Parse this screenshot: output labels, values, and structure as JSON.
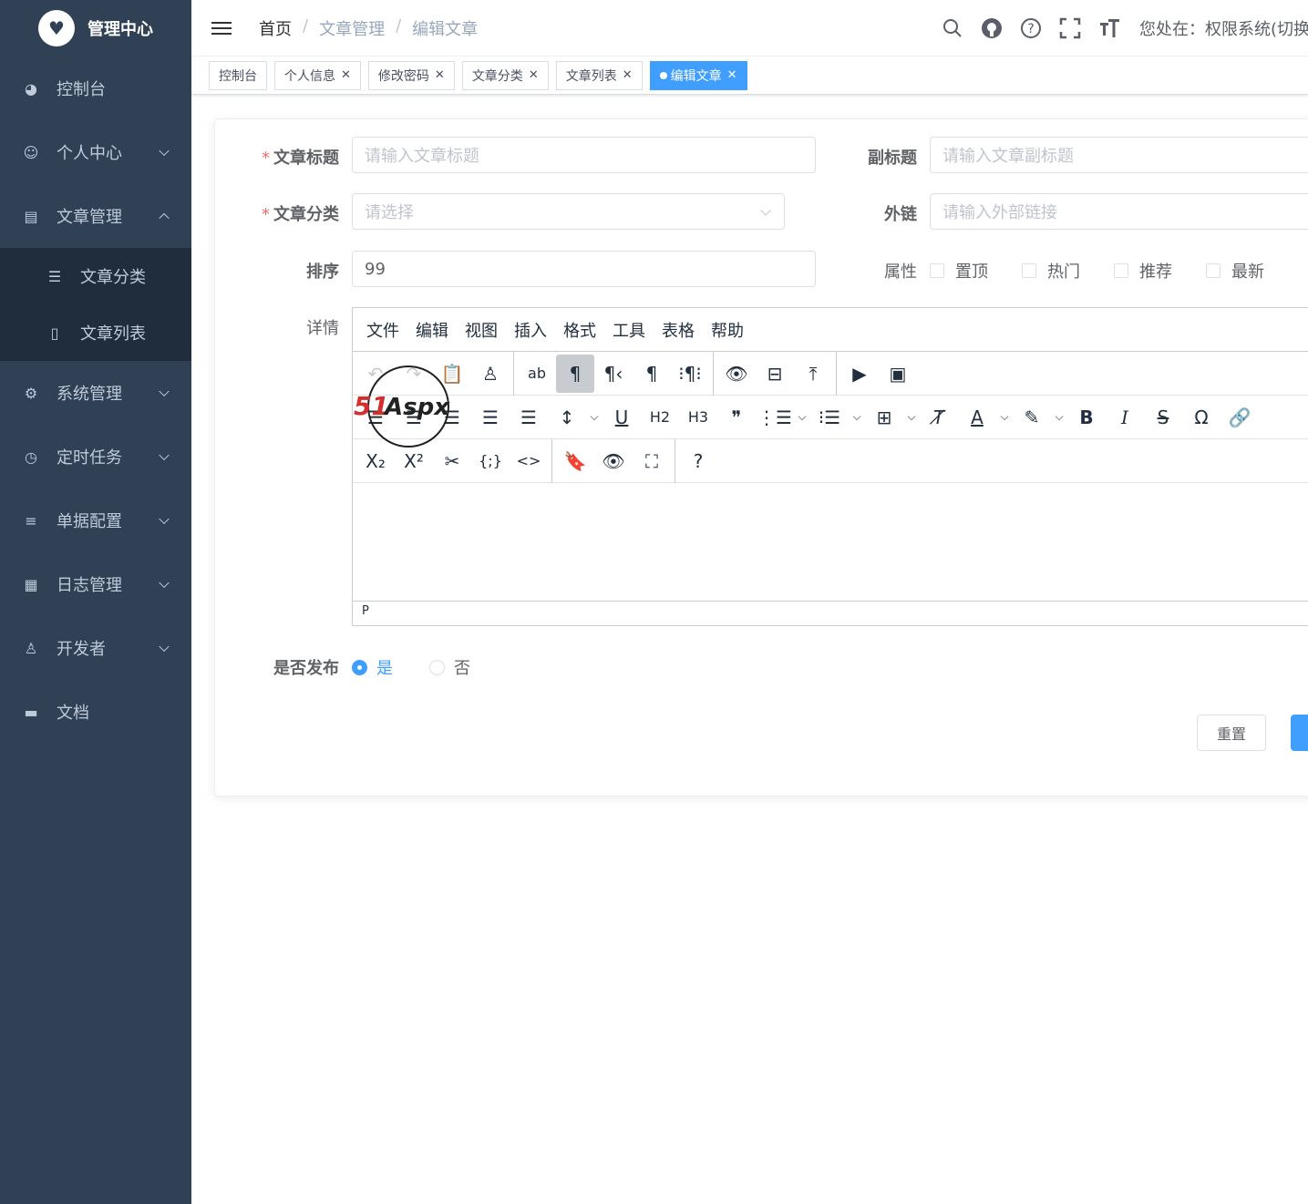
{
  "app": {
    "title": "管理中心",
    "logo_glyph": "♥"
  },
  "sidebar": {
    "items": [
      {
        "label": "控制台",
        "icon": "dashboard-icon"
      },
      {
        "label": "个人中心",
        "icon": "user-circle-icon"
      },
      {
        "label": "文章管理",
        "icon": "article-icon"
      },
      {
        "label": "系统管理",
        "icon": "gear-icon"
      },
      {
        "label": "定时任务",
        "icon": "clock-icon"
      },
      {
        "label": "单据配置",
        "icon": "sliders-icon"
      },
      {
        "label": "日志管理",
        "icon": "log-icon"
      },
      {
        "label": "开发者",
        "icon": "developer-icon"
      },
      {
        "label": "文档",
        "icon": "document-icon"
      }
    ],
    "submenu": [
      {
        "label": "文章分类",
        "icon": "list-icon"
      },
      {
        "label": "文章列表",
        "icon": "file-icon"
      }
    ]
  },
  "navbar": {
    "breadcrumb": [
      "首页",
      "文章管理",
      "编辑文章"
    ],
    "breadcrumb_sep": "/",
    "user_text": "您处在：权限系统(切换"
  },
  "tags": [
    {
      "label": "控制台"
    },
    {
      "label": "个人信息"
    },
    {
      "label": "修改密码"
    },
    {
      "label": "文章分类"
    },
    {
      "label": "文章列表"
    },
    {
      "label": "编辑文章"
    }
  ],
  "form": {
    "title_label": "文章标题",
    "title_placeholder": "请输入文章标题",
    "subtitle_label": "副标题",
    "subtitle_placeholder": "请输入文章副标题",
    "category_label": "文章分类",
    "category_placeholder": "请选择",
    "link_label": "外链",
    "link_placeholder": "请输入外部链接",
    "sort_label": "排序",
    "sort_value": "99",
    "attr_label": "属性",
    "attrs": [
      "置顶",
      "热门",
      "推荐",
      "最新"
    ],
    "detail_label": "详情",
    "publish_label": "是否发布",
    "publish_yes": "是",
    "publish_no": "否",
    "required_mark": "*",
    "reset_button": "重置"
  },
  "editor": {
    "menu": [
      "文件",
      "编辑",
      "视图",
      "插入",
      "格式",
      "工具",
      "表格",
      "帮助"
    ],
    "status_path": "P",
    "h2": "H2",
    "h3": "H3"
  },
  "colors": {
    "sidebar": "#304156",
    "primary": "#409eff"
  }
}
